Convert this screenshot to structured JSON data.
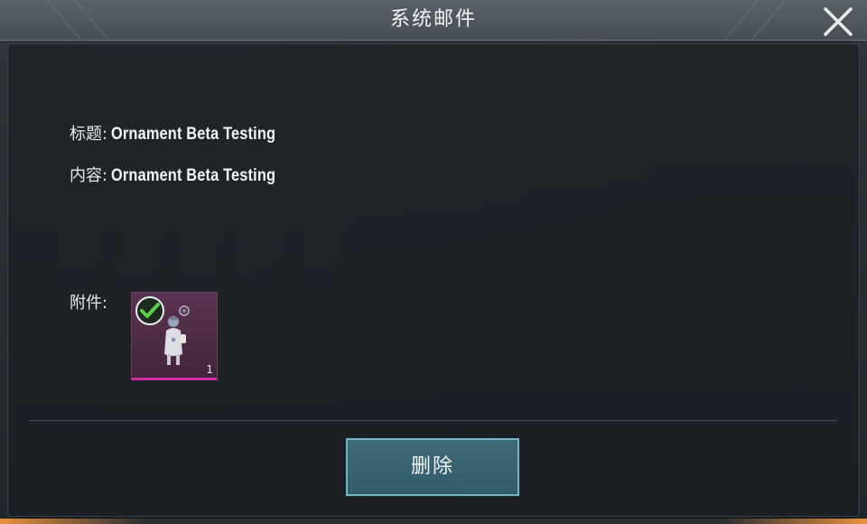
{
  "window": {
    "title": "系统邮件"
  },
  "mail": {
    "subject_label": "标题:",
    "subject": "Ornament Beta Testing",
    "content_label": "内容:",
    "content": "Ornament Beta Testing",
    "attachment_label": "附件:",
    "attachments": [
      {
        "icon": "ornament-doll-icon",
        "quantity": "1",
        "claimed": true,
        "rarity_color": "#d12ea6"
      }
    ]
  },
  "actions": {
    "delete_label": "删除"
  },
  "theme": {
    "accent": "#6fb6c9",
    "button_fill": "#3e6a78",
    "check_color": "#5ad04a"
  }
}
